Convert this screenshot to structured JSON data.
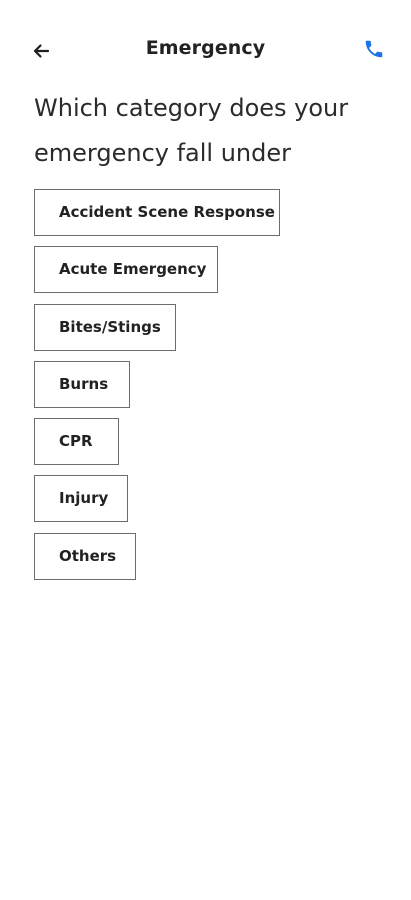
{
  "header": {
    "title": "Emergency",
    "back_icon": "arrow-left-icon",
    "call_icon": "phone-icon",
    "accent_color": "#1a73e8"
  },
  "prompt": {
    "question": "Which category does your emergency fall under"
  },
  "categories": [
    {
      "label": "Accident Scene Response"
    },
    {
      "label": "Acute Emergency"
    },
    {
      "label": "Bites/Stings"
    },
    {
      "label": "Burns"
    },
    {
      "label": "CPR"
    },
    {
      "label": "Injury"
    },
    {
      "label": "Others"
    }
  ]
}
